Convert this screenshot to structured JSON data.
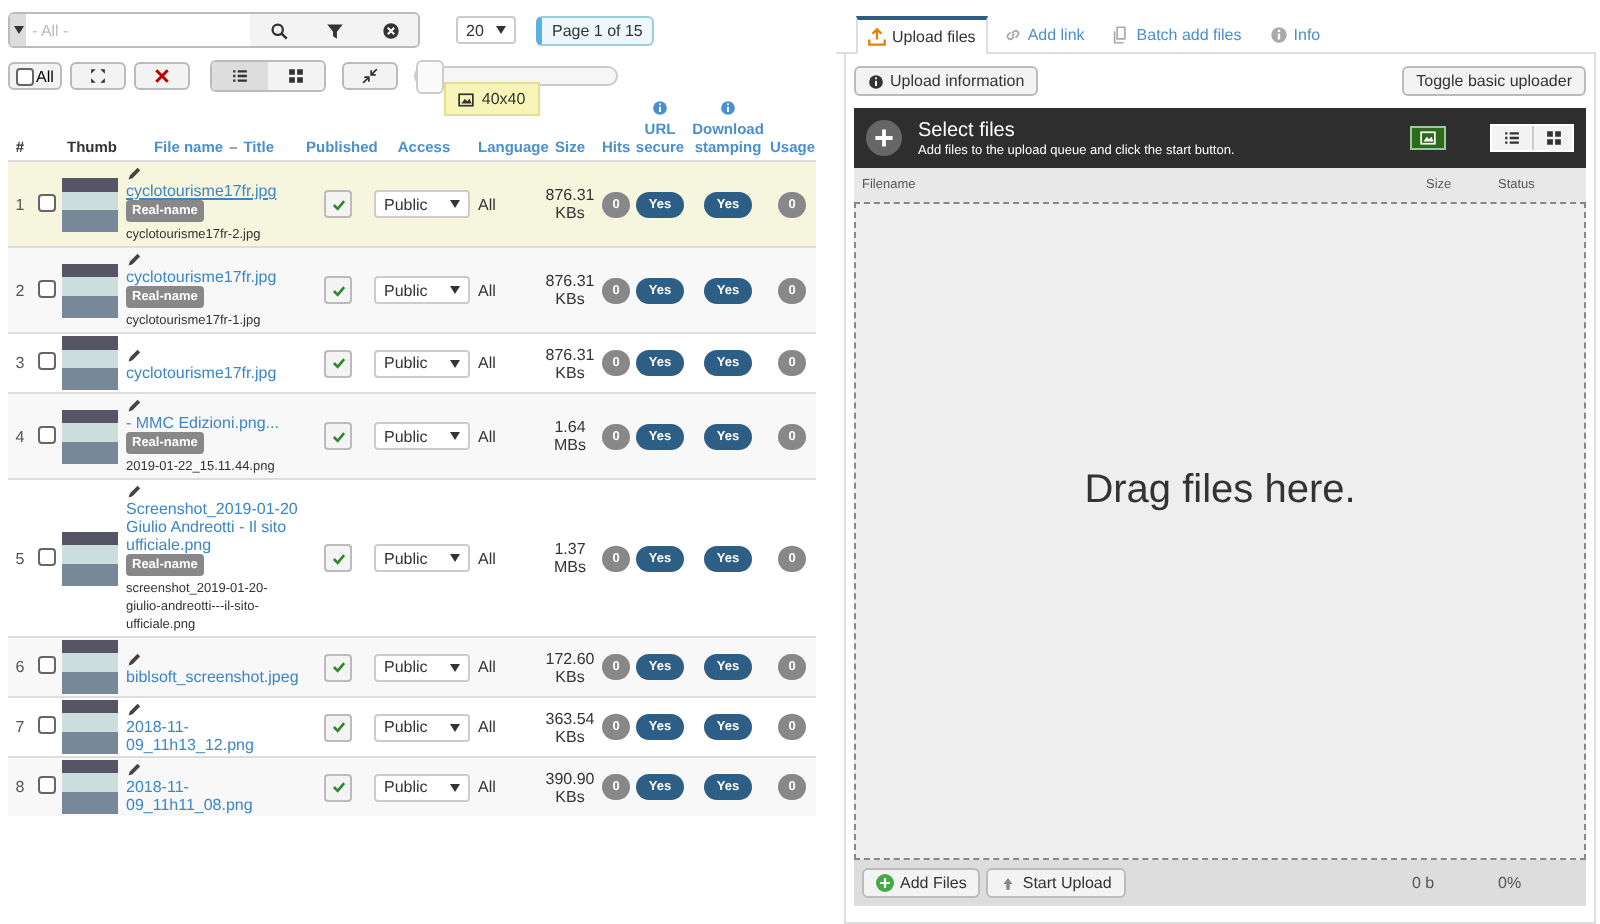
{
  "toolbar": {
    "search": {
      "placeholder": "- All -"
    },
    "per_page": "20",
    "page_info": "Page 1 of 15",
    "all_label": "All",
    "all_checked": false,
    "thumb_size": {
      "level": 0,
      "tooltip": "40x40"
    }
  },
  "table": {
    "columns": [
      {
        "kind": "plain",
        "labels": [
          "#"
        ]
      },
      {
        "kind": "plain",
        "labels": [
          "Thumb"
        ]
      },
      {
        "kind": "sort",
        "labels": [
          "File name",
          "–",
          "Title"
        ]
      },
      {
        "kind": "sort",
        "labels": [
          "Published"
        ]
      },
      {
        "kind": "sort",
        "labels": [
          "Access"
        ]
      },
      {
        "kind": "sort",
        "labels": [
          "Language"
        ]
      },
      {
        "kind": "sort",
        "labels": [
          "Size"
        ]
      },
      {
        "kind": "sort",
        "labels": [
          "Hits"
        ]
      },
      {
        "kind": "info",
        "labels": [
          "URL secure"
        ]
      },
      {
        "kind": "info",
        "labels": [
          "Download stamping"
        ]
      },
      {
        "kind": "sort",
        "labels": [
          "Usage"
        ]
      }
    ],
    "rows": [
      {
        "num": "1",
        "selected": true,
        "checked": false,
        "title": "cyclotourisme17fr.jpg",
        "real_label": "Real-name",
        "real_name": "cyclotourisme17fr-2.jpg",
        "published": true,
        "access": "Public",
        "language": "All",
        "size": "876.31 KBs",
        "hits": "0",
        "url_secure": "Yes",
        "download_stamping": "Yes",
        "usage": "0"
      },
      {
        "num": "2",
        "selected": false,
        "checked": false,
        "title": "cyclotourisme17fr.jpg",
        "real_label": "Real-name",
        "real_name": "cyclotourisme17fr-1.jpg",
        "published": true,
        "access": "Public",
        "language": "All",
        "size": "876.31 KBs",
        "hits": "0",
        "url_secure": "Yes",
        "download_stamping": "Yes",
        "usage": "0"
      },
      {
        "num": "3",
        "selected": false,
        "checked": false,
        "title": "cyclotourisme17fr.jpg",
        "published": true,
        "access": "Public",
        "language": "All",
        "size": "876.31 KBs",
        "hits": "0",
        "url_secure": "Yes",
        "download_stamping": "Yes",
        "usage": "0"
      },
      {
        "num": "4",
        "selected": false,
        "checked": false,
        "title": "- MMC Edizioni.png...",
        "real_label": "Real-name",
        "real_name": "2019-01-22_15.11.44.png",
        "published": true,
        "access": "Public",
        "language": "All",
        "size": "1.64 MBs",
        "hits": "0",
        "url_secure": "Yes",
        "download_stamping": "Yes",
        "usage": "0"
      },
      {
        "num": "5",
        "selected": false,
        "checked": false,
        "title": "Screenshot_2019-01-20 Giulio Andreotti - Il sito ufficiale.png",
        "real_label": "Real-name",
        "real_name": "screenshot_2019-01-20-giulio-andreotti---il-sito-ufficiale.png",
        "published": true,
        "access": "Public",
        "language": "All",
        "size": "1.37 MBs",
        "hits": "0",
        "url_secure": "Yes",
        "download_stamping": "Yes",
        "usage": "0"
      },
      {
        "num": "6",
        "selected": false,
        "checked": false,
        "title": "biblsoft_screenshot.jpeg",
        "published": true,
        "access": "Public",
        "language": "All",
        "size": "172.60 KBs",
        "hits": "0",
        "url_secure": "Yes",
        "download_stamping": "Yes",
        "usage": "0"
      },
      {
        "num": "7",
        "selected": false,
        "checked": false,
        "title": "2018-11-09_11h13_12.png",
        "published": true,
        "access": "Public",
        "language": "All",
        "size": "363.54 KBs",
        "hits": "0",
        "url_secure": "Yes",
        "download_stamping": "Yes",
        "usage": "0"
      },
      {
        "num": "8",
        "selected": false,
        "checked": false,
        "title": "2018-11-09_11h11_08.png",
        "published": true,
        "access": "Public",
        "language": "All",
        "size": "390.90 KBs",
        "hits": "0",
        "url_secure": "Yes",
        "download_stamping": "Yes",
        "usage": "0"
      }
    ]
  },
  "uploader": {
    "tabs": [
      {
        "kind": "upload",
        "label": "Upload files",
        "selected": true
      },
      {
        "kind": "link",
        "label": "Add link",
        "selected": false
      },
      {
        "kind": "batch",
        "label": "Batch add files",
        "selected": false
      },
      {
        "kind": "info",
        "label": "Info",
        "selected": false
      }
    ],
    "info_button": "Upload information",
    "toggle_button": "Toggle basic uploader",
    "header": {
      "title": "Select files",
      "subtitle": "Add files to the upload queue and click the start button."
    },
    "queue_columns": [
      "Filename",
      "Size",
      "Status"
    ],
    "drop_text": "Drag files here.",
    "add_button": "Add Files",
    "start_button": "Start Upload",
    "total_size": "0 b",
    "percent": "0%"
  }
}
